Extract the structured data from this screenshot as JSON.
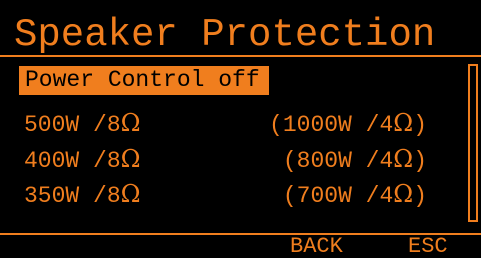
{
  "header": {
    "title": "Speaker Protection"
  },
  "menu": {
    "selected_item": "Power Control off",
    "rows": [
      {
        "left": "500W /8",
        "right": "(1000W /4"
      },
      {
        "left": "400W /8",
        "right": "(800W /4"
      },
      {
        "left": "350W /8",
        "right": "(700W /4"
      }
    ],
    "ohm": "Ω",
    "close_paren": ")"
  },
  "softkeys": {
    "back": "BACK",
    "esc": "ESC"
  },
  "colors": {
    "accent": "#f07e1e",
    "background": "#000000"
  }
}
